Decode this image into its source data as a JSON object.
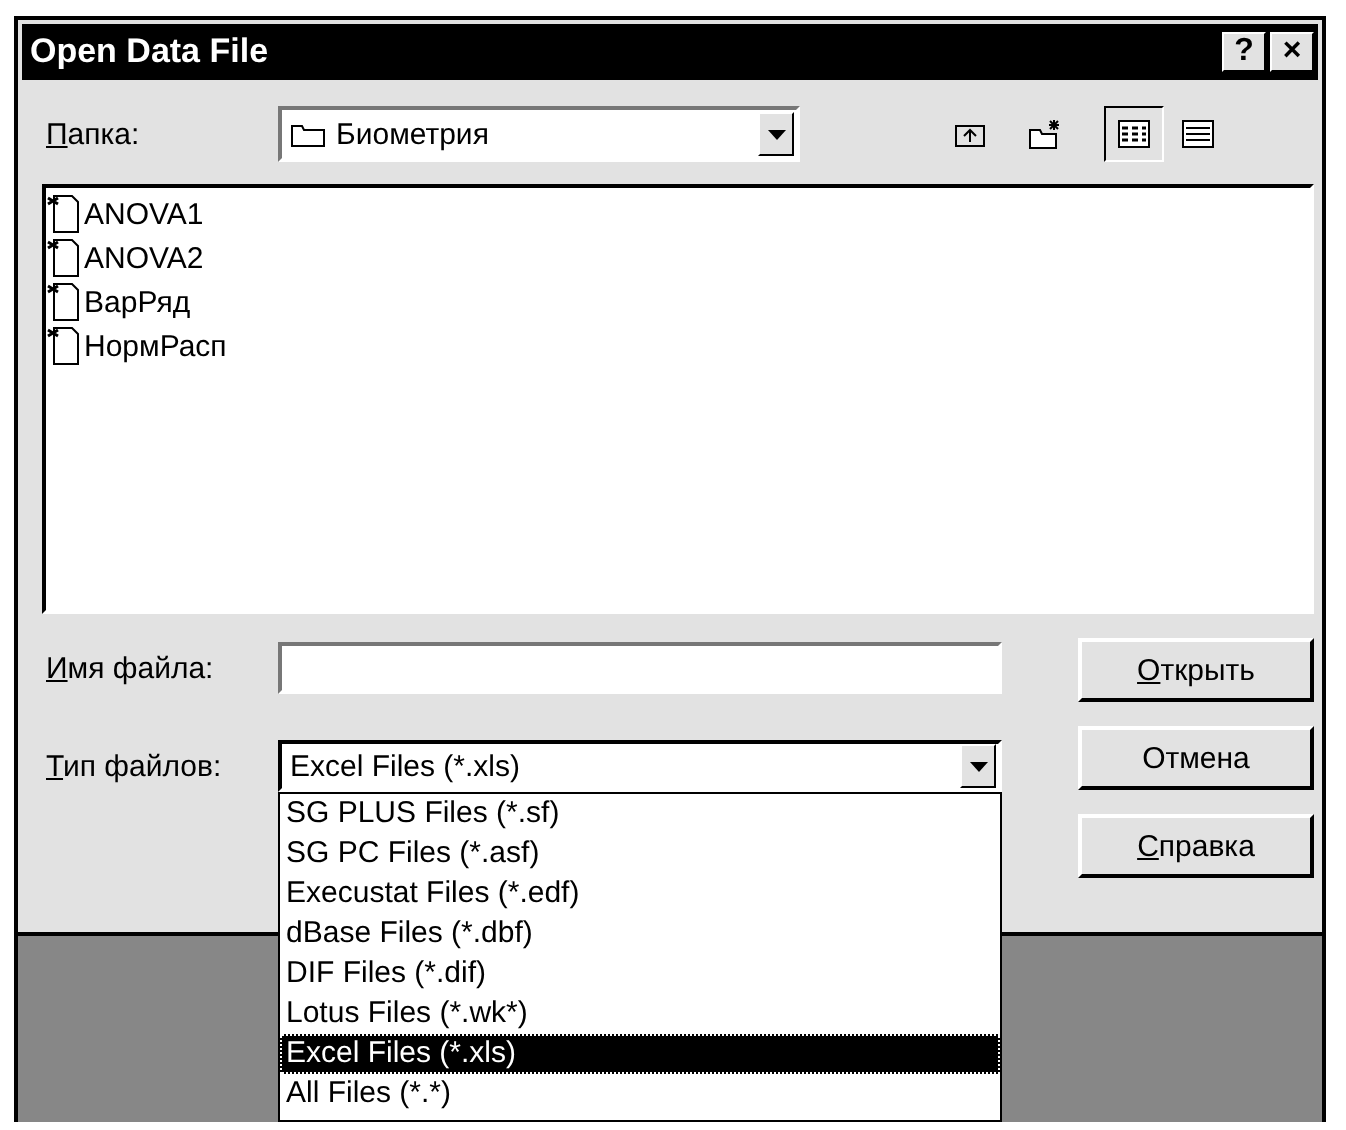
{
  "window": {
    "title": "Open Data File",
    "help": "?",
    "close": "×"
  },
  "folder": {
    "label": "Папка:",
    "value": "Биометрия"
  },
  "files": [
    {
      "name": "ANOVA1"
    },
    {
      "name": "ANOVA2"
    },
    {
      "name": "ВарРяд"
    },
    {
      "name": "НормРасп"
    }
  ],
  "file_name": {
    "label": "Имя файла:"
  },
  "file_type": {
    "label": "Тип файлов:",
    "value": "Excel Files (*.xls)",
    "expanded": true,
    "options": [
      {
        "label": "SG PLUS Files (*.sf)",
        "selected": false
      },
      {
        "label": "SG PC Files (*.asf)",
        "selected": false
      },
      {
        "label": "Execustat Files (*.edf)",
        "selected": false
      },
      {
        "label": "dBase Files (*.dbf)",
        "selected": false
      },
      {
        "label": "DIF Files (*.dif)",
        "selected": false
      },
      {
        "label": "Lotus Files (*.wk*)",
        "selected": false
      },
      {
        "label": "Excel Files (*.xls)",
        "selected": true
      },
      {
        "label": "All Files (*.*)",
        "selected": false
      }
    ]
  },
  "buttons": [
    "Открыть",
    "Отмена",
    "Справка"
  ]
}
